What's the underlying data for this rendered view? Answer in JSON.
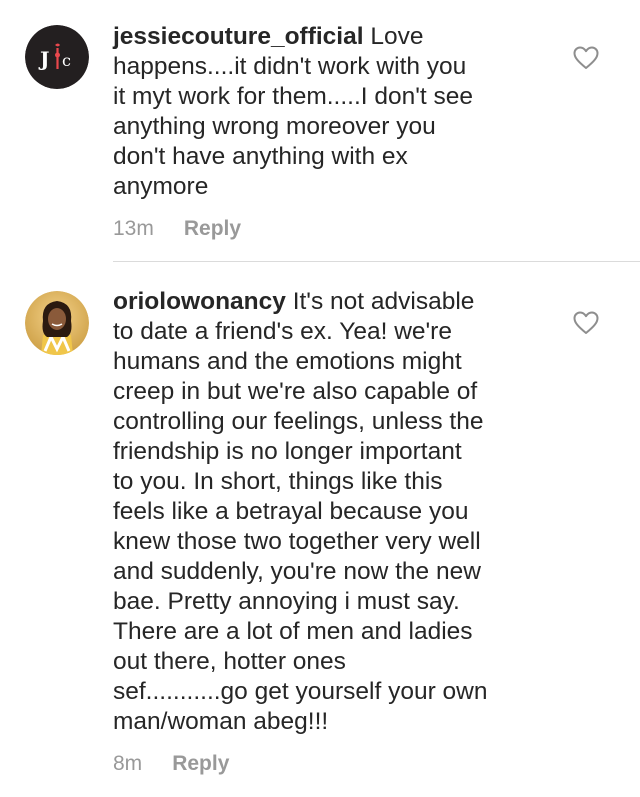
{
  "comments": [
    {
      "username": "jessiecouture_official",
      "text_lines": [
        " Love",
        "happens....it didn't work with you",
        "it myt work for them.....I don't see",
        "anything wrong moreover you",
        "don't have anything with ex",
        "anymore"
      ],
      "time": "13m",
      "reply_label": "Reply",
      "avatar_logo_letters": "JC",
      "avatar_colors": {
        "background": "#231f20",
        "letter": "#ffffff",
        "accent": "#e8484d"
      },
      "like_icon": "heart-outline-icon"
    },
    {
      "username": "oriolowonancy",
      "text_lines": [
        " It's not advisable",
        "to date a friend's ex. Yea! we're",
        "humans and the emotions might",
        "creep in but we're also capable of",
        "controlling our feelings, unless the",
        "friendship is no longer important",
        "to you. In short, things like this",
        "feels like a betrayal because you",
        "knew those two together very well",
        "and suddenly, you're now the new",
        "bae. Pretty annoying i must say.",
        "There are a lot of men and ladies",
        "out there, hotter ones",
        "sef...........go get yourself your own",
        "man/woman abeg!!!"
      ],
      "time": "8m",
      "reply_label": "Reply",
      "like_icon": "heart-outline-icon"
    }
  ],
  "colors": {
    "text": "#262626",
    "meta": "#999999",
    "divider": "#dbdbdb",
    "heart_stroke": "#8e8e8e"
  }
}
